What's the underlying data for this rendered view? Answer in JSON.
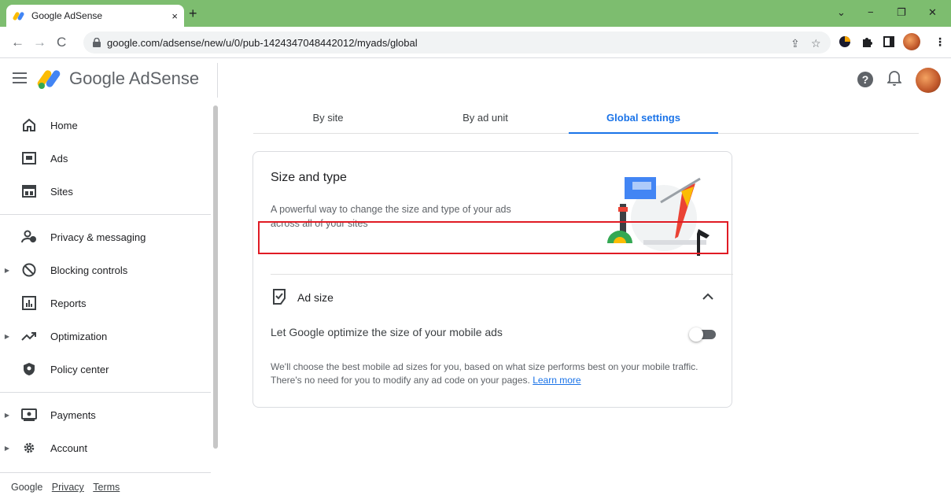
{
  "browser": {
    "tab_title": "Google AdSense",
    "tab_close": "×",
    "new_tab": "+",
    "url": "google.com/adsense/new/u/0/pub-1424347048442012/myads/global",
    "window_controls": {
      "minimize": "−",
      "restore": "❐",
      "close": "✕",
      "chevron": "⌄"
    }
  },
  "header": {
    "brand": "Google AdSense",
    "help": "?"
  },
  "sidebar": {
    "items": [
      {
        "label": "Home",
        "icon": "home-icon",
        "caret": false
      },
      {
        "label": "Ads",
        "icon": "ads-icon",
        "caret": false
      },
      {
        "label": "Sites",
        "icon": "sites-icon",
        "caret": false
      },
      {
        "label": "Privacy & messaging",
        "icon": "privacy-icon",
        "caret": false
      },
      {
        "label": "Blocking controls",
        "icon": "block-icon",
        "caret": true
      },
      {
        "label": "Reports",
        "icon": "reports-icon",
        "caret": false
      },
      {
        "label": "Optimization",
        "icon": "trending-up-icon",
        "caret": true
      },
      {
        "label": "Policy center",
        "icon": "shield-icon",
        "caret": false
      },
      {
        "label": "Payments",
        "icon": "payments-icon",
        "caret": true
      },
      {
        "label": "Account",
        "icon": "gear-icon",
        "caret": true
      }
    ],
    "footer": {
      "google": "Google",
      "privacy": "Privacy",
      "terms": "Terms"
    }
  },
  "tabs": [
    {
      "label": "By site"
    },
    {
      "label": "By ad unit"
    },
    {
      "label": "Global settings",
      "active": true
    }
  ],
  "card": {
    "title": "Size and type",
    "description": "A powerful way to change the size and type of your ads across all of your sites",
    "section_title": "Ad size",
    "option_label": "Let Google optimize the size of your mobile ads",
    "option_enabled": false,
    "explanation": "We'll choose the best mobile ad sizes for you, based on what size performs best on your mobile traffic. There's no need for you to modify any ad code on your pages.",
    "learn_more": "Learn more"
  },
  "colors": {
    "accent": "#1a73e8",
    "tabbar": "#7dbd6f",
    "highlight": "#e01b24"
  }
}
